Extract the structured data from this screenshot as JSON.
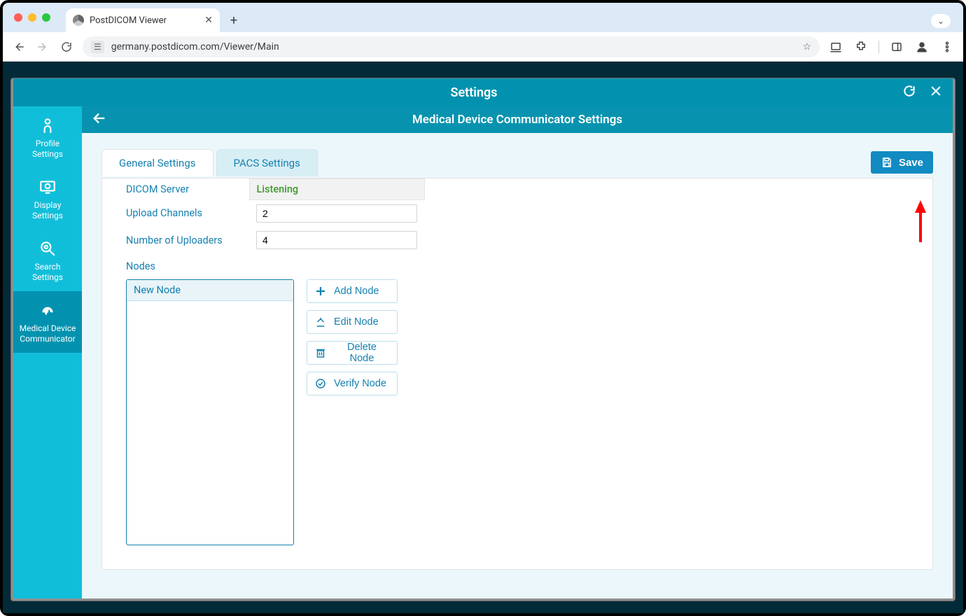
{
  "browser": {
    "tab_title": "PostDICOM Viewer",
    "url": "germany.postdicom.com/Viewer/Main"
  },
  "modal": {
    "title": "Settings"
  },
  "sidebar": {
    "items": [
      {
        "label": "Profile\nSettings"
      },
      {
        "label": "Display\nSettings"
      },
      {
        "label": "Search\nSettings"
      },
      {
        "label": "Medical Device\nCommunicator"
      }
    ]
  },
  "pane": {
    "title": "Medical Device Communicator Settings",
    "tabs": {
      "general": "General Settings",
      "pacs": "PACS Settings"
    },
    "save_label": "Save",
    "fields": {
      "dicom_server_label": "DICOM Server",
      "dicom_server_status": "Listening",
      "upload_channels_label": "Upload Channels",
      "upload_channels_value": "2",
      "num_uploaders_label": "Number of Uploaders",
      "num_uploaders_value": "4"
    },
    "nodes_label": "Nodes",
    "nodes": {
      "items": [
        {
          "label": "New Node"
        }
      ]
    },
    "node_buttons": {
      "add": "Add Node",
      "edit": "Edit Node",
      "delete": "Delete Node",
      "verify": "Verify Node"
    }
  }
}
